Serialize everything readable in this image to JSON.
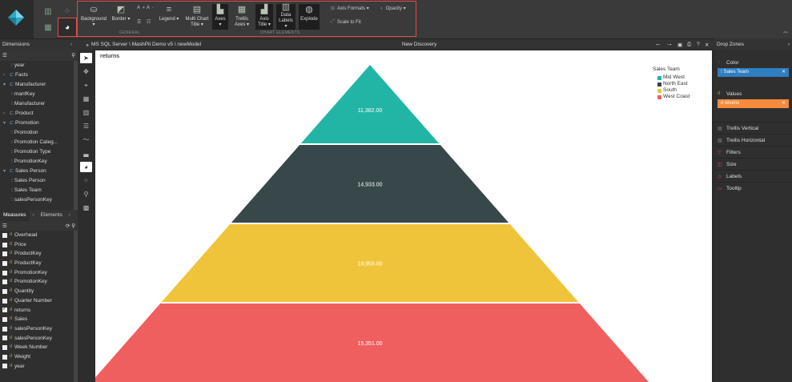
{
  "ribbon": {
    "general_label": "GENERAL",
    "chart_elements_label": "CHART ELEMENTS",
    "background": "Background ▾",
    "border": "Border ▾",
    "font_up": "A",
    "font_down": "A",
    "legend": "Legend ▾",
    "multi_chart": "Multi Chart",
    "multi_chart_sub": "Title ▾",
    "axes": "Axes ▾",
    "trellis": "Trellis",
    "trellis_sub": "Axes ▾",
    "axis": "Axis",
    "axis_sub": "Title ▾",
    "data": "Data",
    "data_sub": "Labels ▾",
    "explode": "Explode",
    "axis_formats": "Axis Formats ▾",
    "opacity": "Opacity ▾",
    "scale_to_fit": "Scale to Fit"
  },
  "pathbar": {
    "dimensions": "Dimensions",
    "source": "MS SQL Server \\ MashPit Demo v5 \\ newModel",
    "title": "New Discovery",
    "drop_zones": "Drop Zones"
  },
  "dimensions": [
    {
      "label": "year",
      "level": 2,
      "kind": "field"
    },
    {
      "label": "Facts",
      "level": 1,
      "kind": "folder",
      "open": false
    },
    {
      "label": "Manufacturer",
      "level": 1,
      "kind": "folder",
      "open": true
    },
    {
      "label": "manfKey",
      "level": 2,
      "kind": "field"
    },
    {
      "label": "Manufacturer",
      "level": 2,
      "kind": "field"
    },
    {
      "label": "Product",
      "level": 1,
      "kind": "folder",
      "open": false
    },
    {
      "label": "Promotion",
      "level": 1,
      "kind": "folder",
      "open": true
    },
    {
      "label": "Promotion",
      "level": 2,
      "kind": "field"
    },
    {
      "label": "Promotion Categ...",
      "level": 2,
      "kind": "field"
    },
    {
      "label": "Promotion Type",
      "level": 2,
      "kind": "field"
    },
    {
      "label": "PromotionKey",
      "level": 2,
      "kind": "field"
    },
    {
      "label": "Sales Person",
      "level": 1,
      "kind": "folder",
      "open": true
    },
    {
      "label": "Sales Person",
      "level": 2,
      "kind": "field"
    },
    {
      "label": "Sales Team",
      "level": 2,
      "kind": "field"
    },
    {
      "label": "salesPersonKey",
      "level": 2,
      "kind": "field"
    }
  ],
  "measures_tabs": {
    "measures": "Measures",
    "elements": "Elements"
  },
  "measures": [
    {
      "label": "Overhead",
      "checked": false
    },
    {
      "label": "Price",
      "checked": false
    },
    {
      "label": "ProductKey",
      "checked": false
    },
    {
      "label": "ProductKey",
      "checked": false
    },
    {
      "label": "PromotionKey",
      "checked": false
    },
    {
      "label": "PromotionKey",
      "checked": false
    },
    {
      "label": "Quantity",
      "checked": false
    },
    {
      "label": "Quarter Number",
      "checked": false
    },
    {
      "label": "returns",
      "checked": true
    },
    {
      "label": "Sales",
      "checked": false
    },
    {
      "label": "salesPersonKey",
      "checked": false
    },
    {
      "label": "salesPersonKey",
      "checked": false
    },
    {
      "label": "Week Number",
      "checked": false
    },
    {
      "label": "Weight",
      "checked": false
    },
    {
      "label": "year",
      "checked": false
    }
  ],
  "canvas": {
    "title": "returns"
  },
  "chart_data": {
    "type": "pyramid",
    "legend_title": "Sales Team",
    "legend_position": "top-right",
    "segments": [
      {
        "name": "Mid West",
        "value": 11382.0,
        "label": "11,382.00",
        "color": "#22b5a5"
      },
      {
        "name": "North East",
        "value": 14933.0,
        "label": "14,933.00",
        "color": "#37474a"
      },
      {
        "name": "South",
        "value": 18955.0,
        "label": "18,955.00",
        "color": "#f0c43a"
      },
      {
        "name": "West Coast",
        "value": 15351.0,
        "label": "15,351.00",
        "color": "#ef5f5f"
      }
    ]
  },
  "dropzones": {
    "color": "Color",
    "color_chip": "Sales Team",
    "values": "Values",
    "values_chip": "returns",
    "trellis_vertical": "Trellis Vertical",
    "trellis_horizontal": "Trellis Horizontal",
    "filters": "Filters",
    "size": "Size",
    "labels": "Labels",
    "tooltip": "Tooltip"
  },
  "colors": {
    "accent_red": "#e24a4a",
    "chip_blue": "#2f7fc1",
    "chip_orange": "#f58a3c"
  }
}
